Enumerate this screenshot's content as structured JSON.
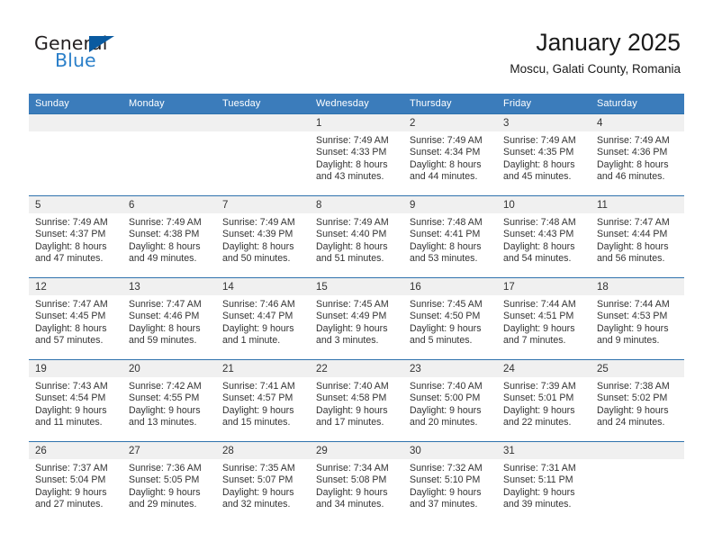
{
  "brand": {
    "logo_text_top": "General",
    "logo_text_bottom": "Blue",
    "logo_icon": "triangle-flag-icon",
    "accent_color": "#2a7fc9",
    "flag_color": "#0a5aa0"
  },
  "header": {
    "title": "January 2025",
    "location": "Moscu, Galati County, Romania"
  },
  "calendar": {
    "header_color": "#3b7cbb",
    "row_border_color": "#2f72ad",
    "daynum_band_color": "#f0f0f0",
    "weekday_headers": [
      "Sunday",
      "Monday",
      "Tuesday",
      "Wednesday",
      "Thursday",
      "Friday",
      "Saturday"
    ],
    "weeks": [
      [
        {
          "day": "",
          "empty": true
        },
        {
          "day": "",
          "empty": true
        },
        {
          "day": "",
          "empty": true
        },
        {
          "day": "1",
          "sunrise": "Sunrise: 7:49 AM",
          "sunset": "Sunset: 4:33 PM",
          "daylight1": "Daylight: 8 hours",
          "daylight2": "and 43 minutes."
        },
        {
          "day": "2",
          "sunrise": "Sunrise: 7:49 AM",
          "sunset": "Sunset: 4:34 PM",
          "daylight1": "Daylight: 8 hours",
          "daylight2": "and 44 minutes."
        },
        {
          "day": "3",
          "sunrise": "Sunrise: 7:49 AM",
          "sunset": "Sunset: 4:35 PM",
          "daylight1": "Daylight: 8 hours",
          "daylight2": "and 45 minutes."
        },
        {
          "day": "4",
          "sunrise": "Sunrise: 7:49 AM",
          "sunset": "Sunset: 4:36 PM",
          "daylight1": "Daylight: 8 hours",
          "daylight2": "and 46 minutes."
        }
      ],
      [
        {
          "day": "5",
          "sunrise": "Sunrise: 7:49 AM",
          "sunset": "Sunset: 4:37 PM",
          "daylight1": "Daylight: 8 hours",
          "daylight2": "and 47 minutes."
        },
        {
          "day": "6",
          "sunrise": "Sunrise: 7:49 AM",
          "sunset": "Sunset: 4:38 PM",
          "daylight1": "Daylight: 8 hours",
          "daylight2": "and 49 minutes."
        },
        {
          "day": "7",
          "sunrise": "Sunrise: 7:49 AM",
          "sunset": "Sunset: 4:39 PM",
          "daylight1": "Daylight: 8 hours",
          "daylight2": "and 50 minutes."
        },
        {
          "day": "8",
          "sunrise": "Sunrise: 7:49 AM",
          "sunset": "Sunset: 4:40 PM",
          "daylight1": "Daylight: 8 hours",
          "daylight2": "and 51 minutes."
        },
        {
          "day": "9",
          "sunrise": "Sunrise: 7:48 AM",
          "sunset": "Sunset: 4:41 PM",
          "daylight1": "Daylight: 8 hours",
          "daylight2": "and 53 minutes."
        },
        {
          "day": "10",
          "sunrise": "Sunrise: 7:48 AM",
          "sunset": "Sunset: 4:43 PM",
          "daylight1": "Daylight: 8 hours",
          "daylight2": "and 54 minutes."
        },
        {
          "day": "11",
          "sunrise": "Sunrise: 7:47 AM",
          "sunset": "Sunset: 4:44 PM",
          "daylight1": "Daylight: 8 hours",
          "daylight2": "and 56 minutes."
        }
      ],
      [
        {
          "day": "12",
          "sunrise": "Sunrise: 7:47 AM",
          "sunset": "Sunset: 4:45 PM",
          "daylight1": "Daylight: 8 hours",
          "daylight2": "and 57 minutes."
        },
        {
          "day": "13",
          "sunrise": "Sunrise: 7:47 AM",
          "sunset": "Sunset: 4:46 PM",
          "daylight1": "Daylight: 8 hours",
          "daylight2": "and 59 minutes."
        },
        {
          "day": "14",
          "sunrise": "Sunrise: 7:46 AM",
          "sunset": "Sunset: 4:47 PM",
          "daylight1": "Daylight: 9 hours",
          "daylight2": "and 1 minute."
        },
        {
          "day": "15",
          "sunrise": "Sunrise: 7:45 AM",
          "sunset": "Sunset: 4:49 PM",
          "daylight1": "Daylight: 9 hours",
          "daylight2": "and 3 minutes."
        },
        {
          "day": "16",
          "sunrise": "Sunrise: 7:45 AM",
          "sunset": "Sunset: 4:50 PM",
          "daylight1": "Daylight: 9 hours",
          "daylight2": "and 5 minutes."
        },
        {
          "day": "17",
          "sunrise": "Sunrise: 7:44 AM",
          "sunset": "Sunset: 4:51 PM",
          "daylight1": "Daylight: 9 hours",
          "daylight2": "and 7 minutes."
        },
        {
          "day": "18",
          "sunrise": "Sunrise: 7:44 AM",
          "sunset": "Sunset: 4:53 PM",
          "daylight1": "Daylight: 9 hours",
          "daylight2": "and 9 minutes."
        }
      ],
      [
        {
          "day": "19",
          "sunrise": "Sunrise: 7:43 AM",
          "sunset": "Sunset: 4:54 PM",
          "daylight1": "Daylight: 9 hours",
          "daylight2": "and 11 minutes."
        },
        {
          "day": "20",
          "sunrise": "Sunrise: 7:42 AM",
          "sunset": "Sunset: 4:55 PM",
          "daylight1": "Daylight: 9 hours",
          "daylight2": "and 13 minutes."
        },
        {
          "day": "21",
          "sunrise": "Sunrise: 7:41 AM",
          "sunset": "Sunset: 4:57 PM",
          "daylight1": "Daylight: 9 hours",
          "daylight2": "and 15 minutes."
        },
        {
          "day": "22",
          "sunrise": "Sunrise: 7:40 AM",
          "sunset": "Sunset: 4:58 PM",
          "daylight1": "Daylight: 9 hours",
          "daylight2": "and 17 minutes."
        },
        {
          "day": "23",
          "sunrise": "Sunrise: 7:40 AM",
          "sunset": "Sunset: 5:00 PM",
          "daylight1": "Daylight: 9 hours",
          "daylight2": "and 20 minutes."
        },
        {
          "day": "24",
          "sunrise": "Sunrise: 7:39 AM",
          "sunset": "Sunset: 5:01 PM",
          "daylight1": "Daylight: 9 hours",
          "daylight2": "and 22 minutes."
        },
        {
          "day": "25",
          "sunrise": "Sunrise: 7:38 AM",
          "sunset": "Sunset: 5:02 PM",
          "daylight1": "Daylight: 9 hours",
          "daylight2": "and 24 minutes."
        }
      ],
      [
        {
          "day": "26",
          "sunrise": "Sunrise: 7:37 AM",
          "sunset": "Sunset: 5:04 PM",
          "daylight1": "Daylight: 9 hours",
          "daylight2": "and 27 minutes."
        },
        {
          "day": "27",
          "sunrise": "Sunrise: 7:36 AM",
          "sunset": "Sunset: 5:05 PM",
          "daylight1": "Daylight: 9 hours",
          "daylight2": "and 29 minutes."
        },
        {
          "day": "28",
          "sunrise": "Sunrise: 7:35 AM",
          "sunset": "Sunset: 5:07 PM",
          "daylight1": "Daylight: 9 hours",
          "daylight2": "and 32 minutes."
        },
        {
          "day": "29",
          "sunrise": "Sunrise: 7:34 AM",
          "sunset": "Sunset: 5:08 PM",
          "daylight1": "Daylight: 9 hours",
          "daylight2": "and 34 minutes."
        },
        {
          "day": "30",
          "sunrise": "Sunrise: 7:32 AM",
          "sunset": "Sunset: 5:10 PM",
          "daylight1": "Daylight: 9 hours",
          "daylight2": "and 37 minutes."
        },
        {
          "day": "31",
          "sunrise": "Sunrise: 7:31 AM",
          "sunset": "Sunset: 5:11 PM",
          "daylight1": "Daylight: 9 hours",
          "daylight2": "and 39 minutes."
        },
        {
          "day": "",
          "empty": true
        }
      ]
    ]
  }
}
